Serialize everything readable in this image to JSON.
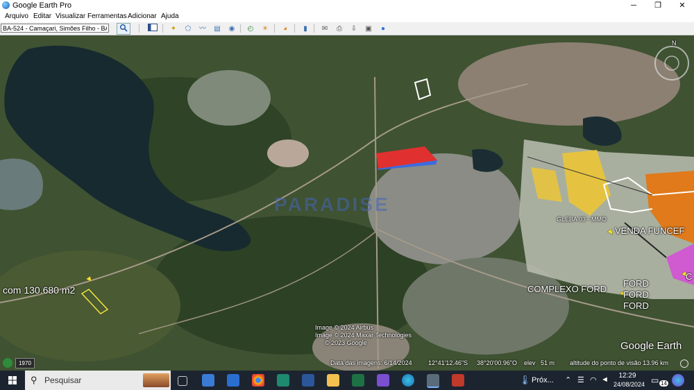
{
  "window": {
    "title": "Google Earth Pro",
    "controls": [
      "─",
      "❐",
      "✕"
    ]
  },
  "menu": [
    "Arquivo",
    "Editar",
    "Visualizar",
    "Ferramentas",
    "Adicionar",
    "Ajuda"
  ],
  "search": {
    "value": "BA-524 - Camaçari, Simões Filho - BA"
  },
  "map": {
    "labels": {
      "left_area": "com 130.680 m2",
      "gleba": "GLEBA 03 - MMO",
      "venda": "VENDA FUNCEF",
      "complexo": "COMPLEXO FORD",
      "ford1": "FORD",
      "ford2": "FORD",
      "ford3": "FORD",
      "edge_c": "C"
    },
    "watermark": "PARADISE",
    "attribution": [
      "Image © 2024 Airbus",
      "Image © 2024 Maxar Technologies",
      "© 2023 Google"
    ],
    "logo": "Google Earth",
    "compass_north": "N"
  },
  "status": {
    "year": "1970",
    "image_date": "Data das imagens: 6/14/2024",
    "lat": "12°41'12.46\"S",
    "lon": "38°20'00.96\"O",
    "elev": "elev   51 m",
    "eye_alt": "altitude do ponto de visão  13.96 km"
  },
  "taskbar": {
    "search_placeholder": "Pesquisar",
    "weather": "Próx...",
    "time": "12:29",
    "date": "24/08/2024",
    "notif_count": "14"
  }
}
